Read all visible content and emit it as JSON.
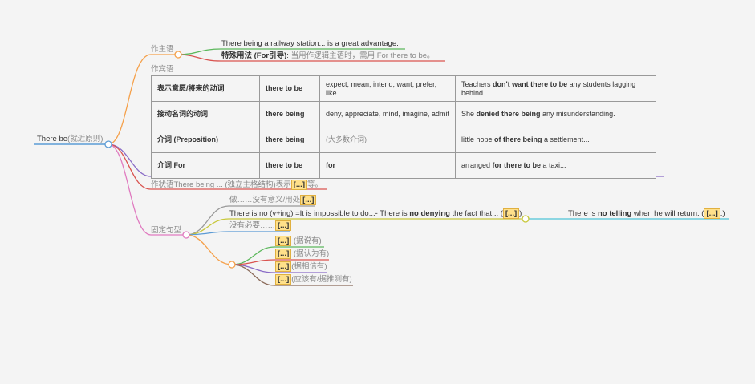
{
  "root": {
    "label": "There be",
    "note": "(就近原则)"
  },
  "subject": {
    "label": "作主语",
    "example": "There being a railway station... is a great advantage.",
    "special_label": "特殊用法 (For引导)",
    "special_colon": ": ",
    "special_text": "当用作逻辑主语时，需用 For there to be。"
  },
  "object": {
    "label": "作宾语",
    "rows": [
      {
        "cat": "表示意愿/将来的动词",
        "form": "there to be",
        "verbs": "expect, mean, intend, want, prefer, like",
        "ex_a": "Teachers ",
        "ex_b": "don't want there to be",
        "ex_c": " any students lagging behind."
      },
      {
        "cat": "接动名词的动词",
        "form": "there being",
        "verbs": "deny, appreciate, mind, imagine, admit",
        "ex_a": "She ",
        "ex_b": "denied there being",
        "ex_c": " any misunderstanding."
      },
      {
        "cat": "介词 (Preposition)",
        "form": "there being",
        "verbs": "(大多数介词)",
        "ex_a": "little hope ",
        "ex_b": "of there being",
        "ex_c": " a settlement..."
      },
      {
        "cat": "介词 For",
        "form": "there to be",
        "verbs": "for",
        "ex_a": "arranged ",
        "ex_b": "for there to be",
        "ex_c": " a taxi..."
      }
    ]
  },
  "adverbial": {
    "pre": "作状语There being ... (独立主格结构)表示",
    "hl": "[...]",
    "post": "等。"
  },
  "fixed": {
    "label": "固定句型",
    "item1_pre": "做……没有意义/用处",
    "item1_hl": "[...]",
    "item2_a": "There is no (v+ing) =It is impossible to do...- There is ",
    "item2_b": "no denying",
    "item2_c": " the fact that... (",
    "item2_hl": "[...]",
    "item2_d": ")",
    "item2_child_a": "There is ",
    "item2_child_b": "no telling",
    "item2_child_c": " when he will return. (",
    "item2_child_hl": "[...]",
    "item2_child_d": ".)",
    "item3_pre": "没有必要……",
    "item3_hl": "[...]",
    "sub": [
      {
        "hl": "[...]",
        "text": " (据说有)"
      },
      {
        "hl": "[...]",
        "text": " (据认为有)"
      },
      {
        "hl": "[...]",
        "text": "(据相信有)"
      },
      {
        "hl": "[...]",
        "text": "(应该有/据推测有)"
      }
    ]
  },
  "colors": {
    "orange": "#f5a04a",
    "purple": "#8a6cc7",
    "pink": "#e07bc0",
    "green": "#5cb85c",
    "red": "#d9534f",
    "blue": "#5b9bd5",
    "yellow": "#c8c83a",
    "gray": "#999999",
    "brown": "#8b6b5a",
    "cyan": "#4ec3d8"
  }
}
